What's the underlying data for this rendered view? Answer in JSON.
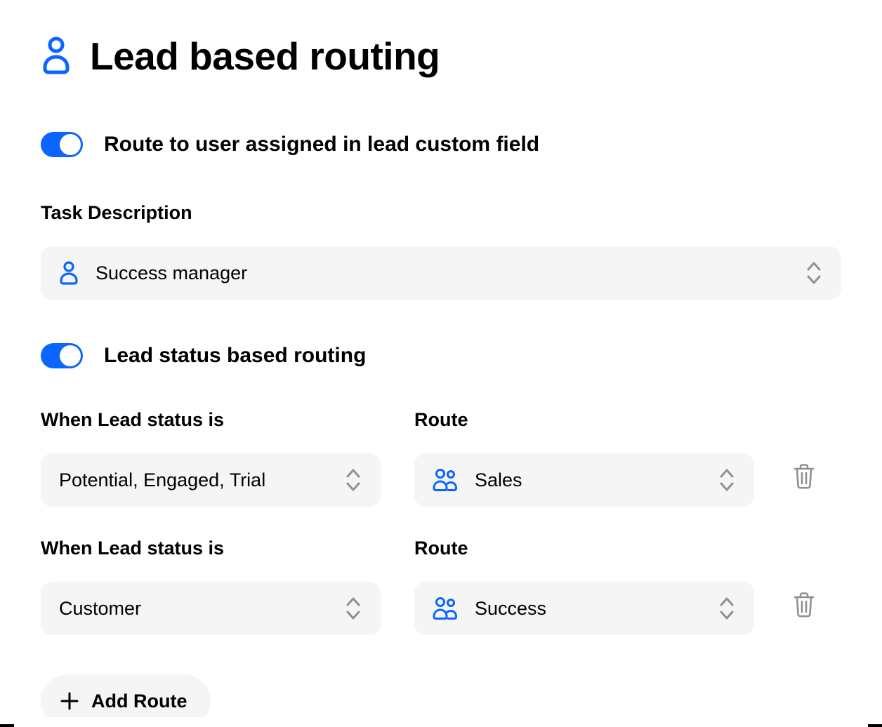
{
  "colors": {
    "accent": "#0a66ff",
    "panel": "#f5f5f5",
    "muted_icon": "#8e9094"
  },
  "header": {
    "title": "Lead based routing",
    "icon": "user-icon"
  },
  "custom_field_routing": {
    "enabled": true,
    "toggle_label": "Route to user assigned in lead custom field",
    "field_label": "Task Description",
    "selected": "Success manager",
    "select_icon": "user-icon"
  },
  "status_routing": {
    "enabled": true,
    "toggle_label": "Lead status based routing",
    "status_label": "When Lead status is",
    "route_label": "Route",
    "rules": [
      {
        "status": "Potential, Engaged, Trial",
        "route": "Sales",
        "route_icon": "users-icon"
      },
      {
        "status": "Customer",
        "route": "Success",
        "route_icon": "users-icon"
      }
    ],
    "add_button_label": "Add Route"
  }
}
